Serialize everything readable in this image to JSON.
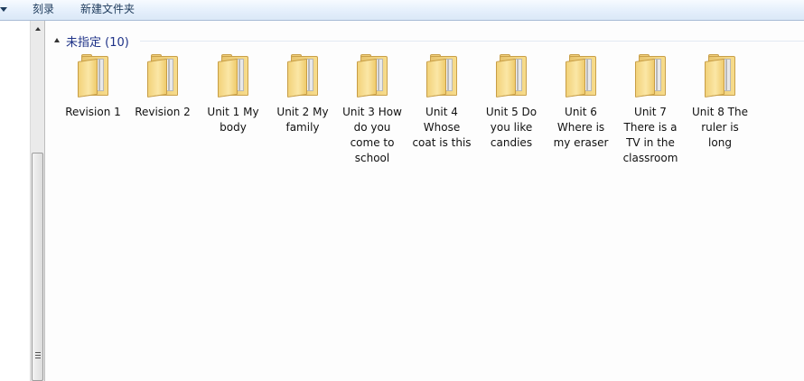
{
  "toolbar": {
    "burn_label": "刻录",
    "new_folder_label": "新建文件夹"
  },
  "group": {
    "title": "未指定 (10)"
  },
  "items": [
    {
      "label": "Revision 1"
    },
    {
      "label": "Revision 2"
    },
    {
      "label": "Unit 1 My body"
    },
    {
      "label": "Unit 2 My family"
    },
    {
      "label": "Unit 3 How do you come to school"
    },
    {
      "label": "Unit 4 Whose coat is this"
    },
    {
      "label": "Unit 5 Do you like candies"
    },
    {
      "label": "Unit 6 Where is my eraser"
    },
    {
      "label": "Unit 7 There is a TV in the classroom"
    },
    {
      "label": "Unit 8 The ruler is long"
    }
  ]
}
